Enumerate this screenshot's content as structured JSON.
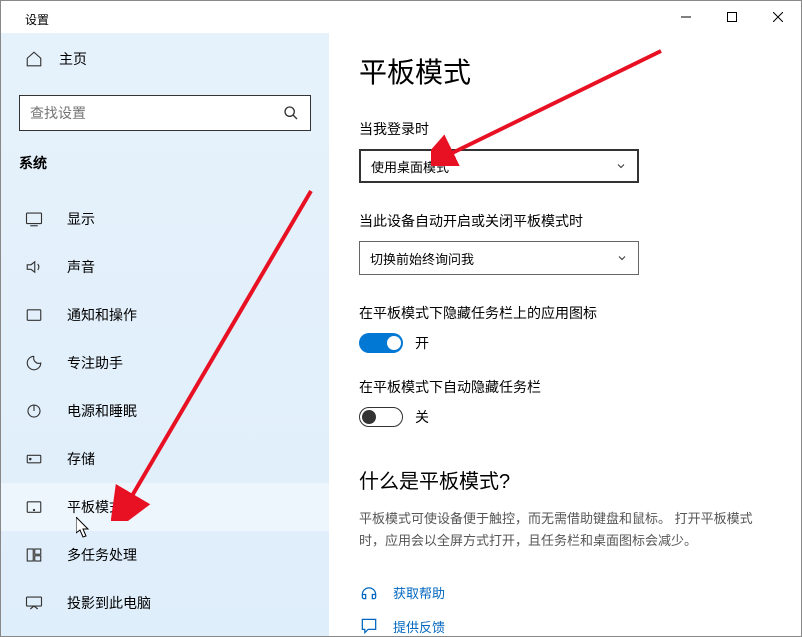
{
  "window": {
    "title": "设置"
  },
  "sidebar": {
    "home": "主页",
    "search_placeholder": "查找设置",
    "section": "系统",
    "items": [
      {
        "label": "显示"
      },
      {
        "label": "声音"
      },
      {
        "label": "通知和操作"
      },
      {
        "label": "专注助手"
      },
      {
        "label": "电源和睡眠"
      },
      {
        "label": "存储"
      },
      {
        "label": "平板模式"
      },
      {
        "label": "多任务处理"
      },
      {
        "label": "投影到此电脑"
      }
    ]
  },
  "main": {
    "heading": "平板模式",
    "signin_label": "当我登录时",
    "signin_value": "使用桌面模式",
    "auto_label": "当此设备自动开启或关闭平板模式时",
    "auto_value": "切换前始终询问我",
    "hide_icons_label": "在平板模式下隐藏任务栏上的应用图标",
    "hide_icons_state": "开",
    "hide_taskbar_label": "在平板模式下自动隐藏任务栏",
    "hide_taskbar_state": "关",
    "what_heading": "什么是平板模式?",
    "what_body": "平板模式可使设备便于触控，而无需借助键盘和鼠标。 打开平板模式时，应用会以全屏方式打开，且任务栏和桌面图标会减少。",
    "help_link": "获取帮助",
    "feedback_link": "提供反馈"
  }
}
